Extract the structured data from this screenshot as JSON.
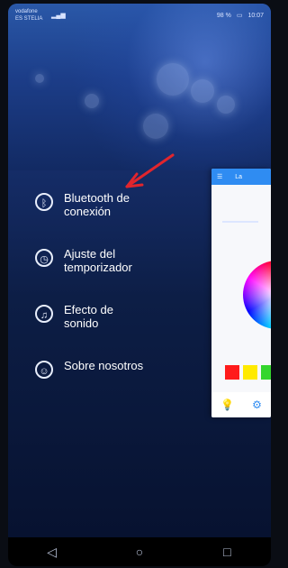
{
  "statusbar": {
    "carrier": "vodafone ES\nSTELIA",
    "time": "10:07",
    "battery": "98 %"
  },
  "menu": {
    "items": [
      {
        "label": "Bluetooth de conexión",
        "icon": "bluetooth-icon"
      },
      {
        "label": "Ajuste del temporizador",
        "icon": "timer-icon"
      },
      {
        "label": "Efecto de sonido",
        "icon": "sound-effect-icon"
      },
      {
        "label": "Sobre nosotros",
        "icon": "user-info-icon"
      }
    ]
  },
  "panel": {
    "title": "La"
  },
  "nav": {
    "back": "◁",
    "home": "○",
    "recent": "□"
  },
  "colors": {
    "accent": "#2f8cf2",
    "arrow": "#e1252d"
  }
}
